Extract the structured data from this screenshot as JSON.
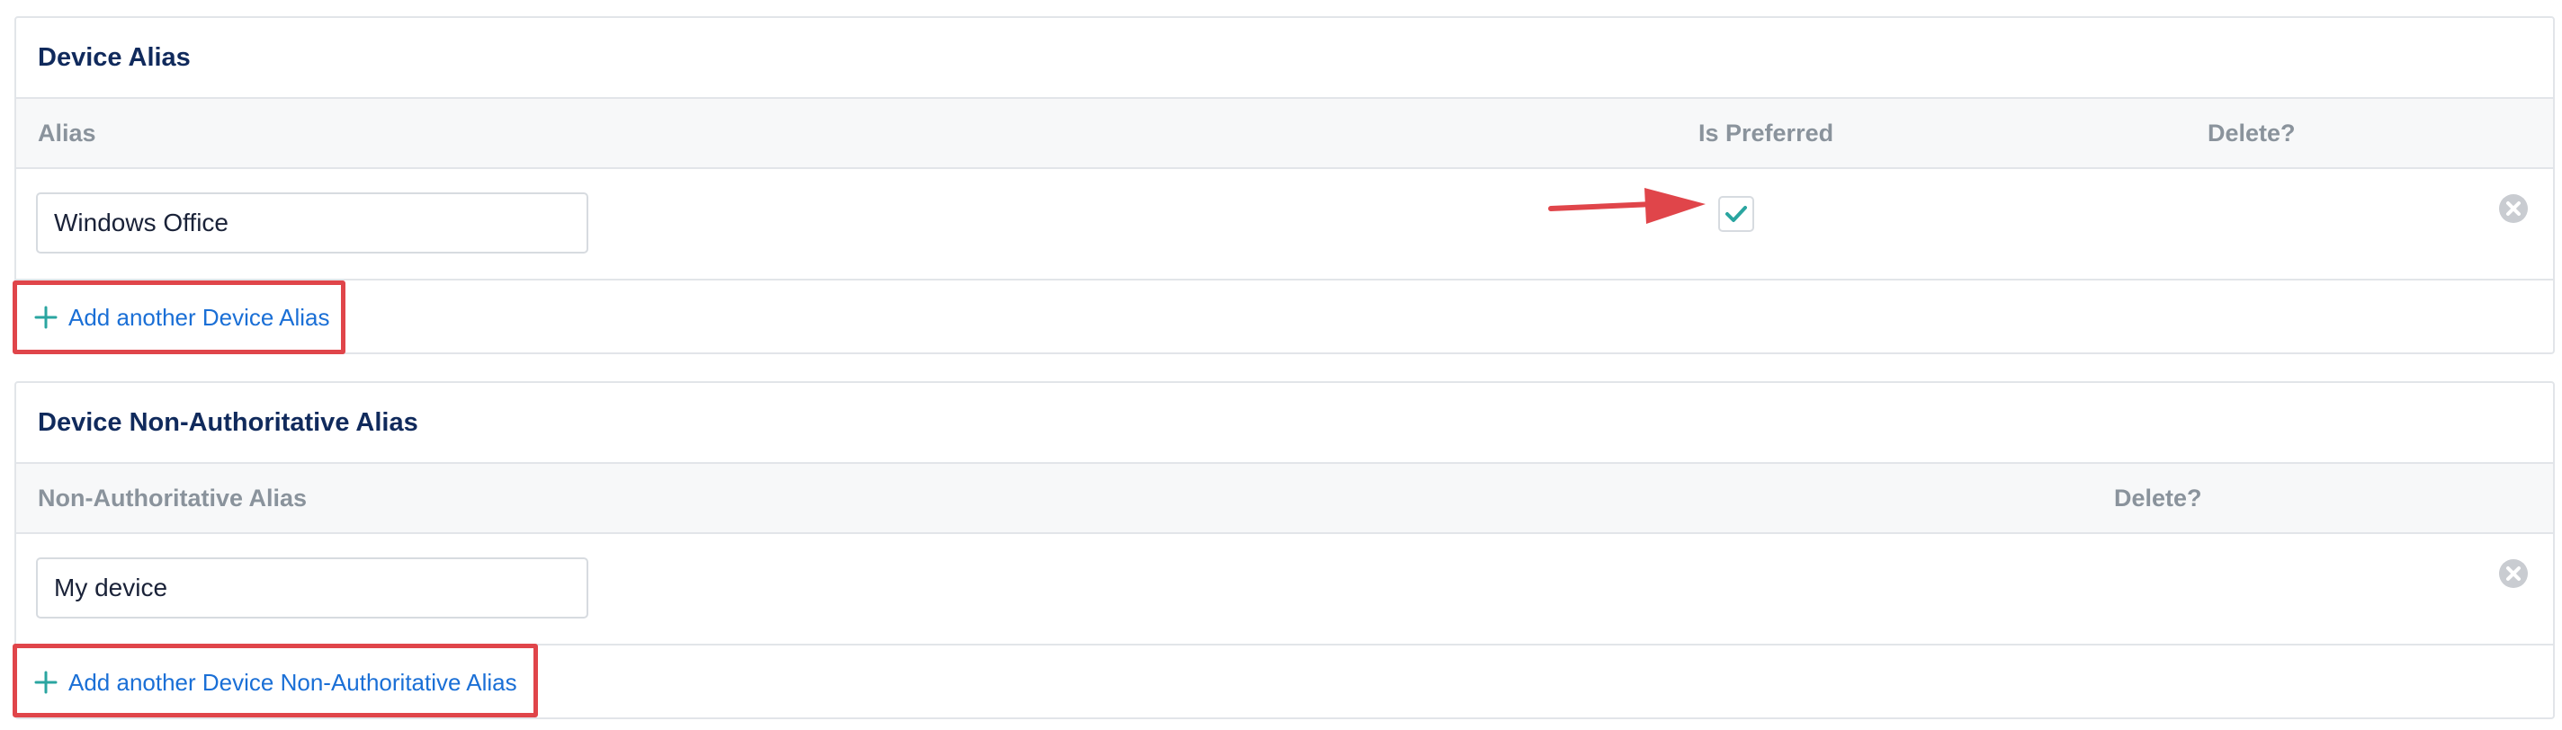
{
  "device_alias": {
    "title": "Device Alias",
    "columns": {
      "alias": "Alias",
      "is_preferred": "Is Preferred",
      "delete": "Delete?"
    },
    "rows": [
      {
        "alias": "Windows Office",
        "is_preferred": true
      }
    ],
    "add_label": "Add another Device Alias"
  },
  "non_authoritative_alias": {
    "title": "Device Non-Authoritative Alias",
    "columns": {
      "alias": "Non-Authoritative Alias",
      "delete": "Delete?"
    },
    "rows": [
      {
        "alias": "My device"
      }
    ],
    "add_label": "Add another Device Non-Authoritative Alias"
  },
  "icons": {
    "add": "plus-icon",
    "delete": "close-circle-icon",
    "checked": "checkmark-icon",
    "annotation": "red-arrow-icon"
  },
  "colors": {
    "title": "#102a5c",
    "link": "#1a6fd6",
    "check": "#2aa5a0",
    "annotation": "#e0454a",
    "header_bg": "#f7f8f9"
  }
}
